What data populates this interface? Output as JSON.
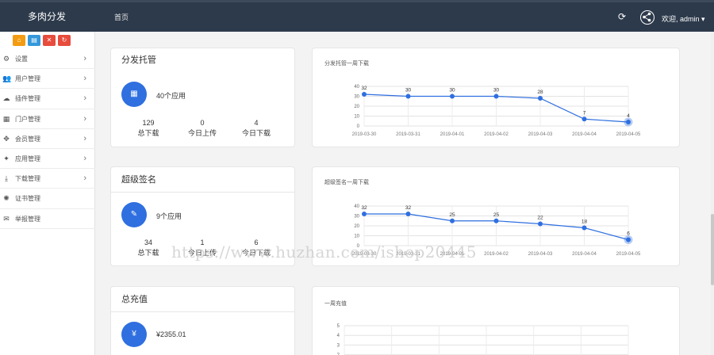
{
  "header": {
    "brand": "多肉分发",
    "home": "首页",
    "refresh_icon": "refresh-icon",
    "share_icon": "share-icon",
    "welcome": "欢迎, admin ▾"
  },
  "sidebar": {
    "quick_buttons": [
      {
        "icon": "home-icon",
        "color": "#f39c12"
      },
      {
        "icon": "file-icon",
        "color": "#3498db"
      },
      {
        "icon": "trash-icon",
        "color": "#e74c3c"
      },
      {
        "icon": "reload-icon",
        "color": "#e74c3c"
      }
    ],
    "items": [
      {
        "label": "设置",
        "icon": "gears-icon",
        "arrow": "›"
      },
      {
        "label": "用户管理",
        "icon": "users-icon",
        "arrow": "›"
      },
      {
        "label": "插件管理",
        "icon": "cloud-icon",
        "arrow": "›"
      },
      {
        "label": "门户管理",
        "icon": "grid-icon",
        "arrow": "›"
      },
      {
        "label": "会员管理",
        "icon": "arrows-icon",
        "arrow": "›"
      },
      {
        "label": "应用管理",
        "icon": "android-icon",
        "arrow": "›"
      },
      {
        "label": "下载管理",
        "icon": "download-icon",
        "arrow": "›"
      },
      {
        "label": "证书管理",
        "icon": "certificate-icon",
        "arrow": ""
      },
      {
        "label": "举报管理",
        "icon": "envelope-icon",
        "arrow": ""
      }
    ]
  },
  "cards": [
    {
      "title": "分发托管",
      "apps": "40个应用",
      "icon": "calendar-icon",
      "stats": [
        {
          "value": "129",
          "label": "总下载"
        },
        {
          "value": "0",
          "label": "今日上传"
        },
        {
          "value": "4",
          "label": "今日下载"
        }
      ]
    },
    {
      "title": "超级签名",
      "apps": "9个应用",
      "icon": "pencil-icon",
      "stats": [
        {
          "value": "34",
          "label": "总下载"
        },
        {
          "value": "1",
          "label": "今日上传"
        },
        {
          "value": "6",
          "label": "今日下载"
        }
      ]
    },
    {
      "title": "总充值",
      "amount": "¥2355.01",
      "icon": "yen-icon"
    }
  ],
  "watermark": "https://www.huzhan.com/ishop20445",
  "chart_data": [
    {
      "type": "line",
      "title": "分发托管一周下载",
      "x": [
        "2019-03-30",
        "2019-03-31",
        "2019-04-01",
        "2019-04-02",
        "2019-04-03",
        "2019-04-04",
        "2019-04-05"
      ],
      "series": [
        {
          "values": [
            32,
            30,
            30,
            30,
            28,
            7,
            4
          ]
        }
      ],
      "ylim": [
        0,
        40
      ],
      "yticks": [
        0,
        10,
        20,
        30,
        40
      ],
      "grid": true,
      "color": "#2f6fe0"
    },
    {
      "type": "line",
      "title": "超级签名一周下载",
      "x": [
        "2019-03-30",
        "2019-03-31",
        "2019-04-01",
        "2019-04-02",
        "2019-04-03",
        "2019-04-04",
        "2019-04-05"
      ],
      "series": [
        {
          "values": [
            32,
            32,
            25,
            25,
            22,
            18,
            6
          ]
        }
      ],
      "ylim": [
        0,
        40
      ],
      "yticks": [
        0,
        10,
        20,
        30,
        40
      ],
      "grid": true,
      "color": "#2f6fe0"
    },
    {
      "type": "line",
      "title": "一周充值",
      "x": [],
      "series": [],
      "ylim": [
        0,
        5
      ],
      "yticks": [
        2,
        3,
        4,
        5
      ],
      "grid": true,
      "color": "#2f6fe0"
    }
  ]
}
